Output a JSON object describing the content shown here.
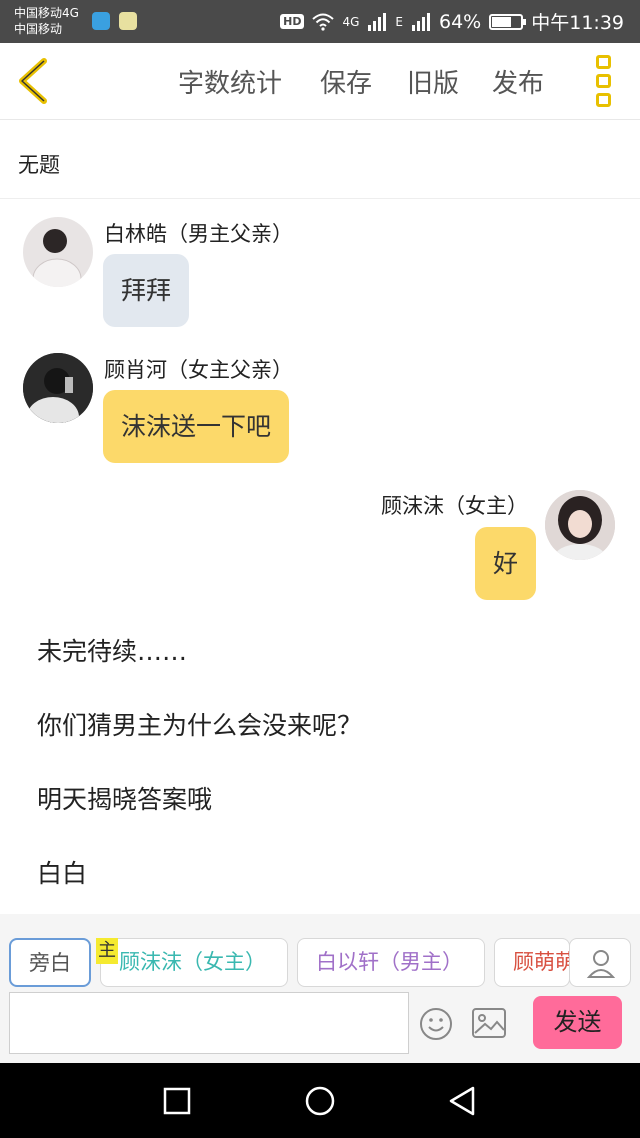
{
  "status_bar": {
    "carrier1": "中国移动4G",
    "carrier2": "中国移动",
    "hd": "HD",
    "network": "4G",
    "network2": "E",
    "battery_text": "64%",
    "battery_level": 0.64,
    "time": "中午11:39"
  },
  "toolbar": {
    "word_count": "字数统计",
    "save": "保存",
    "old_version": "旧版",
    "publish": "发布"
  },
  "document": {
    "title": "无题"
  },
  "messages": [
    {
      "speaker": "白林皓（男主父亲）",
      "text": "拜拜"
    },
    {
      "speaker": "顾肖河（女主父亲）",
      "text": "沫沫送一下吧"
    },
    {
      "speaker": "顾沫沫（女主）",
      "text": "好"
    }
  ],
  "narration": [
    "未完待续……",
    "你们猜男主为什么会没来呢？",
    "明天揭晓答案哦",
    "白白"
  ],
  "roles": {
    "narrator": "旁白",
    "main_marker": "主",
    "tags": [
      {
        "label": "顾沫沫（女主）",
        "color": "#3ab8b0"
      },
      {
        "label": "白以轩（男主）",
        "color": "#a070c8"
      },
      {
        "label": "顾萌萌",
        "color": "#d85040"
      }
    ]
  },
  "input": {
    "value": "",
    "send": "发送"
  },
  "colors": {
    "accent_yellow": "#fcd96a",
    "send_pink": "#ff6b9a",
    "grey_bubble": "#e2e8ef"
  }
}
